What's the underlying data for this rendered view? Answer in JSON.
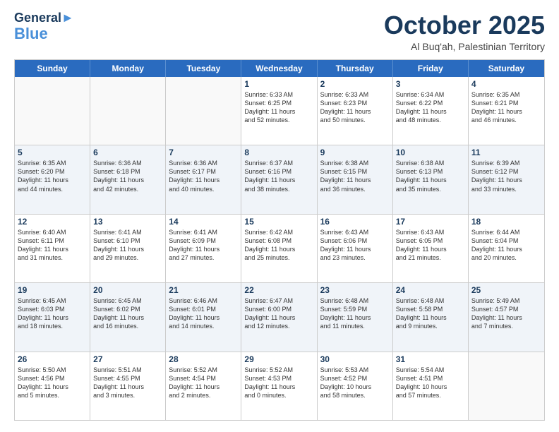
{
  "logo": {
    "line1": "General",
    "line2": "Blue"
  },
  "header": {
    "month": "October 2025",
    "location": "Al Buq'ah, Palestinian Territory"
  },
  "weekdays": [
    "Sunday",
    "Monday",
    "Tuesday",
    "Wednesday",
    "Thursday",
    "Friday",
    "Saturday"
  ],
  "rows": [
    [
      {
        "day": "",
        "empty": true
      },
      {
        "day": "",
        "empty": true
      },
      {
        "day": "",
        "empty": true
      },
      {
        "day": "1",
        "lines": [
          "Sunrise: 6:33 AM",
          "Sunset: 6:25 PM",
          "Daylight: 11 hours",
          "and 52 minutes."
        ]
      },
      {
        "day": "2",
        "lines": [
          "Sunrise: 6:33 AM",
          "Sunset: 6:23 PM",
          "Daylight: 11 hours",
          "and 50 minutes."
        ]
      },
      {
        "day": "3",
        "lines": [
          "Sunrise: 6:34 AM",
          "Sunset: 6:22 PM",
          "Daylight: 11 hours",
          "and 48 minutes."
        ]
      },
      {
        "day": "4",
        "lines": [
          "Sunrise: 6:35 AM",
          "Sunset: 6:21 PM",
          "Daylight: 11 hours",
          "and 46 minutes."
        ]
      }
    ],
    [
      {
        "day": "5",
        "lines": [
          "Sunrise: 6:35 AM",
          "Sunset: 6:20 PM",
          "Daylight: 11 hours",
          "and 44 minutes."
        ]
      },
      {
        "day": "6",
        "lines": [
          "Sunrise: 6:36 AM",
          "Sunset: 6:18 PM",
          "Daylight: 11 hours",
          "and 42 minutes."
        ]
      },
      {
        "day": "7",
        "lines": [
          "Sunrise: 6:36 AM",
          "Sunset: 6:17 PM",
          "Daylight: 11 hours",
          "and 40 minutes."
        ]
      },
      {
        "day": "8",
        "lines": [
          "Sunrise: 6:37 AM",
          "Sunset: 6:16 PM",
          "Daylight: 11 hours",
          "and 38 minutes."
        ]
      },
      {
        "day": "9",
        "lines": [
          "Sunrise: 6:38 AM",
          "Sunset: 6:15 PM",
          "Daylight: 11 hours",
          "and 36 minutes."
        ]
      },
      {
        "day": "10",
        "lines": [
          "Sunrise: 6:38 AM",
          "Sunset: 6:13 PM",
          "Daylight: 11 hours",
          "and 35 minutes."
        ]
      },
      {
        "day": "11",
        "lines": [
          "Sunrise: 6:39 AM",
          "Sunset: 6:12 PM",
          "Daylight: 11 hours",
          "and 33 minutes."
        ]
      }
    ],
    [
      {
        "day": "12",
        "lines": [
          "Sunrise: 6:40 AM",
          "Sunset: 6:11 PM",
          "Daylight: 11 hours",
          "and 31 minutes."
        ]
      },
      {
        "day": "13",
        "lines": [
          "Sunrise: 6:41 AM",
          "Sunset: 6:10 PM",
          "Daylight: 11 hours",
          "and 29 minutes."
        ]
      },
      {
        "day": "14",
        "lines": [
          "Sunrise: 6:41 AM",
          "Sunset: 6:09 PM",
          "Daylight: 11 hours",
          "and 27 minutes."
        ]
      },
      {
        "day": "15",
        "lines": [
          "Sunrise: 6:42 AM",
          "Sunset: 6:08 PM",
          "Daylight: 11 hours",
          "and 25 minutes."
        ]
      },
      {
        "day": "16",
        "lines": [
          "Sunrise: 6:43 AM",
          "Sunset: 6:06 PM",
          "Daylight: 11 hours",
          "and 23 minutes."
        ]
      },
      {
        "day": "17",
        "lines": [
          "Sunrise: 6:43 AM",
          "Sunset: 6:05 PM",
          "Daylight: 11 hours",
          "and 21 minutes."
        ]
      },
      {
        "day": "18",
        "lines": [
          "Sunrise: 6:44 AM",
          "Sunset: 6:04 PM",
          "Daylight: 11 hours",
          "and 20 minutes."
        ]
      }
    ],
    [
      {
        "day": "19",
        "lines": [
          "Sunrise: 6:45 AM",
          "Sunset: 6:03 PM",
          "Daylight: 11 hours",
          "and 18 minutes."
        ]
      },
      {
        "day": "20",
        "lines": [
          "Sunrise: 6:45 AM",
          "Sunset: 6:02 PM",
          "Daylight: 11 hours",
          "and 16 minutes."
        ]
      },
      {
        "day": "21",
        "lines": [
          "Sunrise: 6:46 AM",
          "Sunset: 6:01 PM",
          "Daylight: 11 hours",
          "and 14 minutes."
        ]
      },
      {
        "day": "22",
        "lines": [
          "Sunrise: 6:47 AM",
          "Sunset: 6:00 PM",
          "Daylight: 11 hours",
          "and 12 minutes."
        ]
      },
      {
        "day": "23",
        "lines": [
          "Sunrise: 6:48 AM",
          "Sunset: 5:59 PM",
          "Daylight: 11 hours",
          "and 11 minutes."
        ]
      },
      {
        "day": "24",
        "lines": [
          "Sunrise: 6:48 AM",
          "Sunset: 5:58 PM",
          "Daylight: 11 hours",
          "and 9 minutes."
        ]
      },
      {
        "day": "25",
        "lines": [
          "Sunrise: 5:49 AM",
          "Sunset: 4:57 PM",
          "Daylight: 11 hours",
          "and 7 minutes."
        ]
      }
    ],
    [
      {
        "day": "26",
        "lines": [
          "Sunrise: 5:50 AM",
          "Sunset: 4:56 PM",
          "Daylight: 11 hours",
          "and 5 minutes."
        ]
      },
      {
        "day": "27",
        "lines": [
          "Sunrise: 5:51 AM",
          "Sunset: 4:55 PM",
          "Daylight: 11 hours",
          "and 3 minutes."
        ]
      },
      {
        "day": "28",
        "lines": [
          "Sunrise: 5:52 AM",
          "Sunset: 4:54 PM",
          "Daylight: 11 hours",
          "and 2 minutes."
        ]
      },
      {
        "day": "29",
        "lines": [
          "Sunrise: 5:52 AM",
          "Sunset: 4:53 PM",
          "Daylight: 11 hours",
          "and 0 minutes."
        ]
      },
      {
        "day": "30",
        "lines": [
          "Sunrise: 5:53 AM",
          "Sunset: 4:52 PM",
          "Daylight: 10 hours",
          "and 58 minutes."
        ]
      },
      {
        "day": "31",
        "lines": [
          "Sunrise: 5:54 AM",
          "Sunset: 4:51 PM",
          "Daylight: 10 hours",
          "and 57 minutes."
        ]
      },
      {
        "day": "",
        "empty": true
      }
    ]
  ]
}
